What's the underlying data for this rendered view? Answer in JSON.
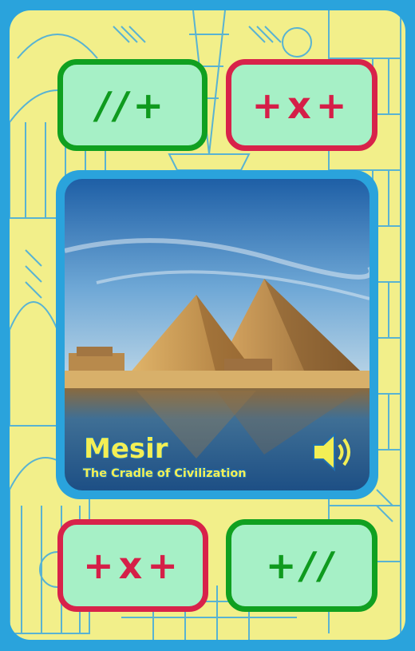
{
  "buttons": {
    "top_left": {
      "symbols": "//+",
      "color": "#10a020"
    },
    "top_right": {
      "symbols": "+x+",
      "color": "#d8224a"
    },
    "bottom_left": {
      "symbols": "+x+",
      "color": "#d8224a"
    },
    "bottom_right": {
      "symbols": "+//",
      "color": "#10a020"
    }
  },
  "card": {
    "title": "Mesir",
    "subtitle": "The Cradle of Civilization",
    "image_icon": "pyramids-photo",
    "speaker_icon": "speaker-icon"
  },
  "colors": {
    "frame": "#2aa3dc",
    "background": "#f2ef8a",
    "button_fill": "#a6f0c6",
    "title": "#f3ef55"
  }
}
